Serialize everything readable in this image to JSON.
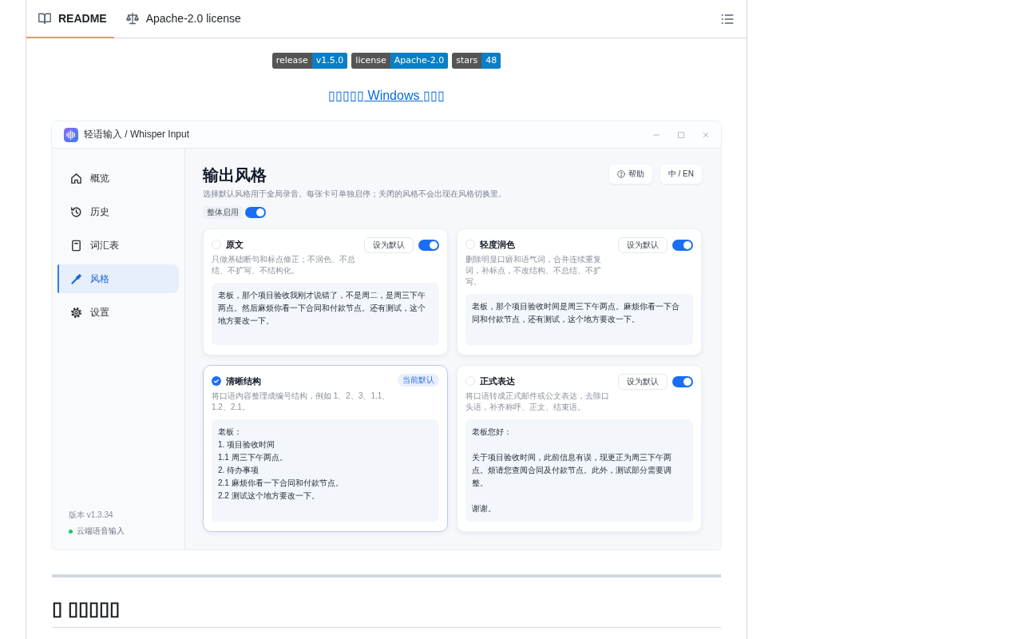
{
  "readme_tabs": [
    {
      "label": "README",
      "selected": true
    },
    {
      "label": "Apache-2.0 license",
      "selected": false
    }
  ],
  "badges": [
    {
      "label": "release",
      "value": "v1.5.0"
    },
    {
      "label": "license",
      "value": "Apache-2.0"
    },
    {
      "label": "stars",
      "value": "48"
    }
  ],
  "download_link": "▯▯▯▯▯ Windows ▯▯▯",
  "app_window": {
    "title": "轻语输入 / Whisper Input",
    "sidebar": {
      "items": [
        {
          "label": "概览",
          "selected": false
        },
        {
          "label": "历史",
          "selected": false
        },
        {
          "label": "词汇表",
          "selected": false
        },
        {
          "label": "风格",
          "selected": true
        },
        {
          "label": "设置",
          "selected": false
        }
      ],
      "version": "版本 v1.3.34",
      "status": "云端语音输入"
    },
    "page_title": "输出风格",
    "header_buttons": [
      "帮助",
      "中 / EN"
    ],
    "subtitle": "选择默认风格用于全局录音。每张卡可单独启停；关闭的风格不会出现在风格切换里。",
    "master_toggle": {
      "label": "整体启用",
      "on": true
    },
    "styles": [
      {
        "kind": "plain",
        "title": "原文",
        "description": "只做基础断句和标点修正；不润色、不总结、不扩写、不结构化。",
        "selected": false,
        "button": "设为默认",
        "on": true,
        "preview": [
          "老板，那个项目验收我刚才说错了，不是周二，是周三下午两点。然后麻烦你看一下合同和付款节点。还有测试，这个地方要改一下。"
        ]
      },
      {
        "kind": "plain",
        "title": "轻度润色",
        "description": "删除明显口癖和语气词，合并连续重复词，补标点，不改结构、不总结、不扩写。",
        "selected": false,
        "button": "设为默认",
        "on": true,
        "preview": [
          "老板，那个项目验收时间是周三下午两点。麻烦你看一下合同和付款节点，还有测试，这个地方要改一下。"
        ]
      },
      {
        "kind": "plain",
        "title": "清晰结构",
        "description": "将口语内容整理成编号结构，例如 1、2、3、1.1、1.2、2.1。",
        "selected": true,
        "badge": "当前默认",
        "preview": [
          "老板：",
          "1. 项目验收时间",
          "1.1 周三下午两点。",
          "2. 待办事项",
          "2.1 麻烦你看一下合同和付款节点。",
          "2.2 测试这个地方要改一下。"
        ]
      },
      {
        "kind": "letter",
        "title": "正式表达",
        "description": "将口语转成正式邮件或公文表达，去除口头语，补齐称呼、正文、结束语。",
        "selected": false,
        "button": "设为默认",
        "on": true,
        "preview": [
          "老板您好：",
          "关于项目验收时间，此前信息有误，现更正为周三下午两点。烦请您查阅合同及付款节点。此外，测试部分需要调整。",
          "谢谢。"
        ]
      }
    ]
  },
  "section_heading": "▯ ▯▯▯▯▯"
}
